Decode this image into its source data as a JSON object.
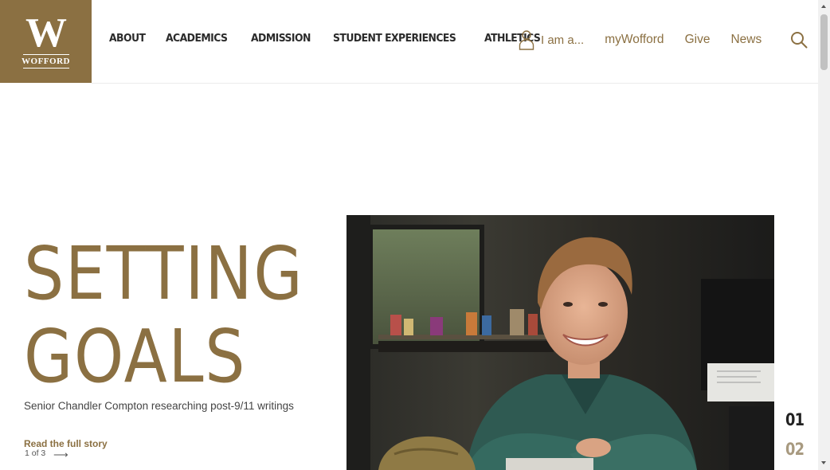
{
  "logo": {
    "letter": "W",
    "name": "WOFFORD"
  },
  "nav": {
    "main": [
      {
        "label": "ABOUT"
      },
      {
        "label": "ACADEMICS"
      },
      {
        "label": "ADMISSION"
      },
      {
        "label": "STUDENT EXPERIENCES"
      },
      {
        "label": "ATHLETICS"
      }
    ],
    "iam_label": "I am a...",
    "mywofford": "myWofford",
    "give": "Give",
    "news": "News"
  },
  "hero": {
    "title_line1": "SETTING",
    "title_line2": "GOALS",
    "subtitle": "Senior Chandler Compton researching post-9/11 writings",
    "cta": "Read the full story",
    "slide_count": "1 of 3",
    "arrow": "⟶",
    "slide_nums": [
      "01",
      "02"
    ]
  },
  "colors": {
    "brand": "#8b7042",
    "text": "#2b2b2b"
  },
  "icons": {
    "user": "user-icon",
    "search": "search-icon",
    "arrow": "arrow-right-icon"
  }
}
